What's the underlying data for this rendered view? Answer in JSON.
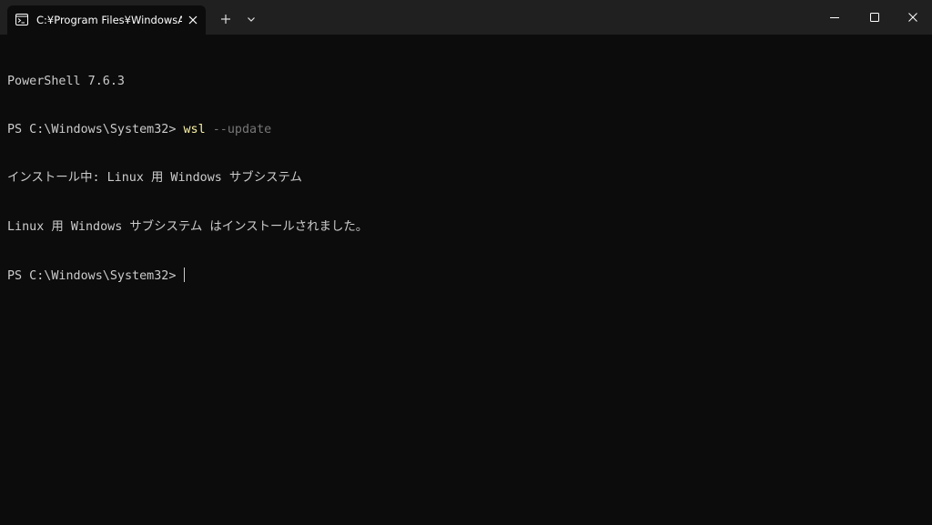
{
  "tab": {
    "title": "C:¥Program Files¥WindowsAp",
    "icon": "terminal-icon"
  },
  "titlebar": {
    "new_tab_icon": "plus-icon",
    "dropdown_icon": "chevron-down-icon",
    "minimize_icon": "minimize-icon",
    "maximize_icon": "maximize-icon",
    "close_icon": "close-icon"
  },
  "terminal": {
    "line1": "PowerShell 7.6.3",
    "line2_prompt": "PS C:\\Windows\\System32> ",
    "line2_command": "wsl",
    "line2_args": " --update",
    "line3": "インストール中: Linux 用 Windows サブシステム",
    "line4": "Linux 用 Windows サブシステム はインストールされました。",
    "line5_prompt": "PS C:\\Windows\\System32> "
  },
  "colors": {
    "background": "#0c0c0c",
    "titlebar": "#202020",
    "text": "#cccccc",
    "command": "#f9f1a5",
    "argument": "#767676"
  }
}
